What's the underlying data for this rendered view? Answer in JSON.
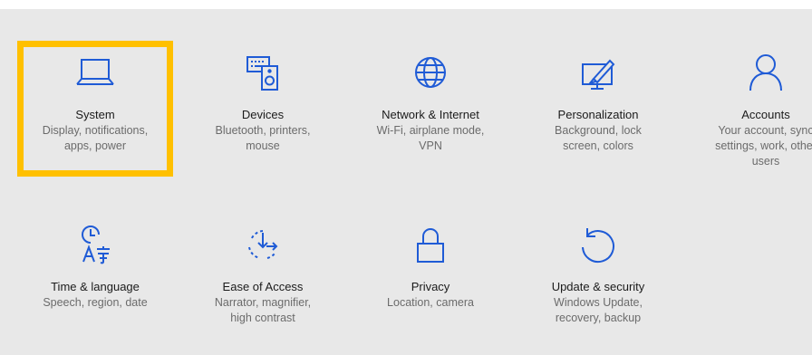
{
  "colors": {
    "accent": "#1f5bd6",
    "selection": "#ffc000",
    "background": "#e8e8e8"
  },
  "tiles": [
    {
      "title": "System",
      "desc": [
        "Display, notifications,",
        "apps, power"
      ],
      "icon": "laptop-icon",
      "selected": true
    },
    {
      "title": "Devices",
      "desc": [
        "Bluetooth, printers,",
        "mouse"
      ],
      "icon": "devices-icon"
    },
    {
      "title": "Network & Internet",
      "desc": [
        "Wi-Fi, airplane mode,",
        "VPN"
      ],
      "icon": "globe-icon"
    },
    {
      "title": "Personalization",
      "desc": [
        "Background, lock",
        "screen, colors"
      ],
      "icon": "paintbrush-monitor-icon"
    },
    {
      "title": "Accounts",
      "desc": [
        "Your account, sync",
        "settings, work, other",
        "users"
      ],
      "icon": "person-icon"
    },
    {
      "title": "Time & language",
      "desc": [
        "Speech, region, date"
      ],
      "icon": "time-language-icon"
    },
    {
      "title": "Ease of Access",
      "desc": [
        "Narrator, magnifier,",
        "high contrast"
      ],
      "icon": "ease-of-access-icon"
    },
    {
      "title": "Privacy",
      "desc": [
        "Location, camera"
      ],
      "icon": "lock-icon"
    },
    {
      "title": "Update & security",
      "desc": [
        "Windows Update,",
        "recovery, backup"
      ],
      "icon": "refresh-icon"
    }
  ]
}
